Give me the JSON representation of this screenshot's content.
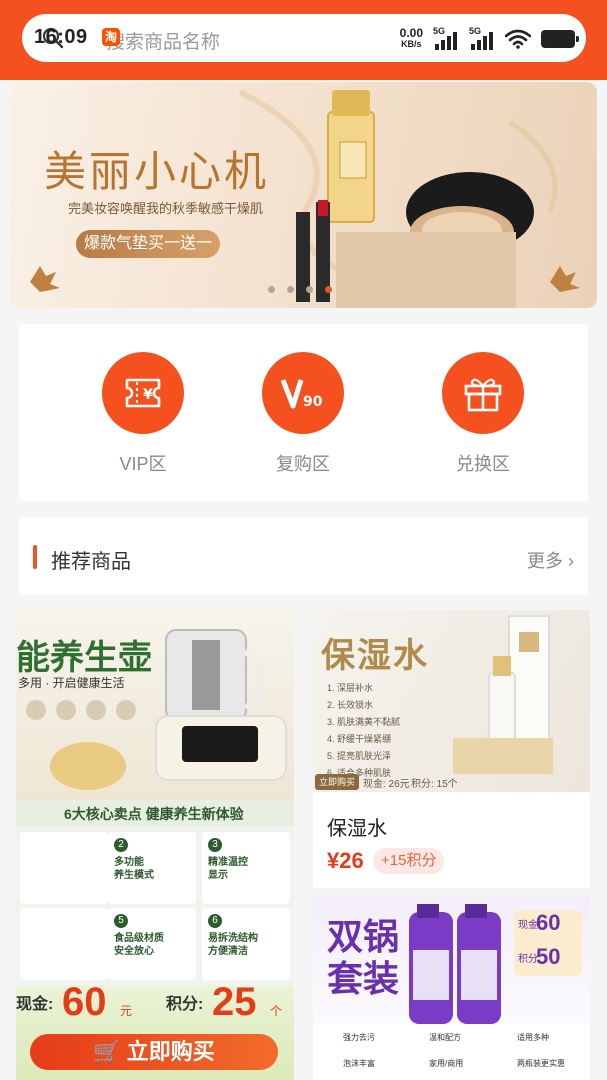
{
  "status_bar": {
    "time": "16:09",
    "net_speed": "0.00",
    "net_unit": "KB/s",
    "signal1": "5G",
    "signal2": "5G"
  },
  "search": {
    "placeholder": "搜索商品名称",
    "badge": "淘"
  },
  "banner": {
    "title": "美丽小心机",
    "subtitle": "完美妆容唤醒我的秋季敏感干燥肌",
    "cta": "爆款气垫买一送一",
    "dot_count": 4,
    "active_dot": 3
  },
  "zones": [
    {
      "label": "VIP区",
      "icon": "vip-ticket-icon"
    },
    {
      "label": "复购区",
      "icon": "v90-icon"
    },
    {
      "label": "兑换区",
      "icon": "gift-icon"
    }
  ],
  "recommend": {
    "title": "推荐商品",
    "more": "更多",
    "more_arrow": "›"
  },
  "products": {
    "kettle": {
      "headline": "能养生壶",
      "tagline": "多用 · 开启健康生活",
      "feature_band": "6大核心卖点  健康养生新体验",
      "features": [
        {
          "n": "2",
          "text": "多功能\n养生模式"
        },
        {
          "n": "3",
          "text": "精准温控\n显示"
        },
        {
          "n": "5",
          "text": "食品级材质\n安全放心"
        },
        {
          "n": "6",
          "text": "易拆洗结构\n方便清洁"
        }
      ],
      "cash_label": "现金:",
      "cash": "60",
      "cash_unit": "元",
      "points_label": "积分:",
      "points": "25",
      "points_unit": "个",
      "buy": "立即购买"
    },
    "serum": {
      "headline": "保湿水",
      "list": [
        "1. 深层补水",
        "2. 长效锁水",
        "3. 肌肤满黄不黏腻",
        "4. 舒缓干燥紧绷",
        "5. 提亮肌肤光泽",
        "6. 适合多种肌肤"
      ],
      "meta_pill": "立即购买",
      "meta_cash": "现金: 26元",
      "meta_points": "积分: 15个",
      "name": "保湿水",
      "price": "¥26",
      "points": "+15积分"
    },
    "pot": {
      "headline": "双锅\n套装",
      "promo_cash_label": "现金",
      "promo_cash": "60",
      "promo_points_label": "积分",
      "promo_points": "50",
      "foot_items": [
        "强力去污",
        "温和配方",
        "适用多种",
        "泡沫丰富",
        "家用/商用",
        "两瓶装更实惠"
      ]
    }
  },
  "colors": {
    "brand": "#f4511e",
    "price": "#e53c18"
  }
}
